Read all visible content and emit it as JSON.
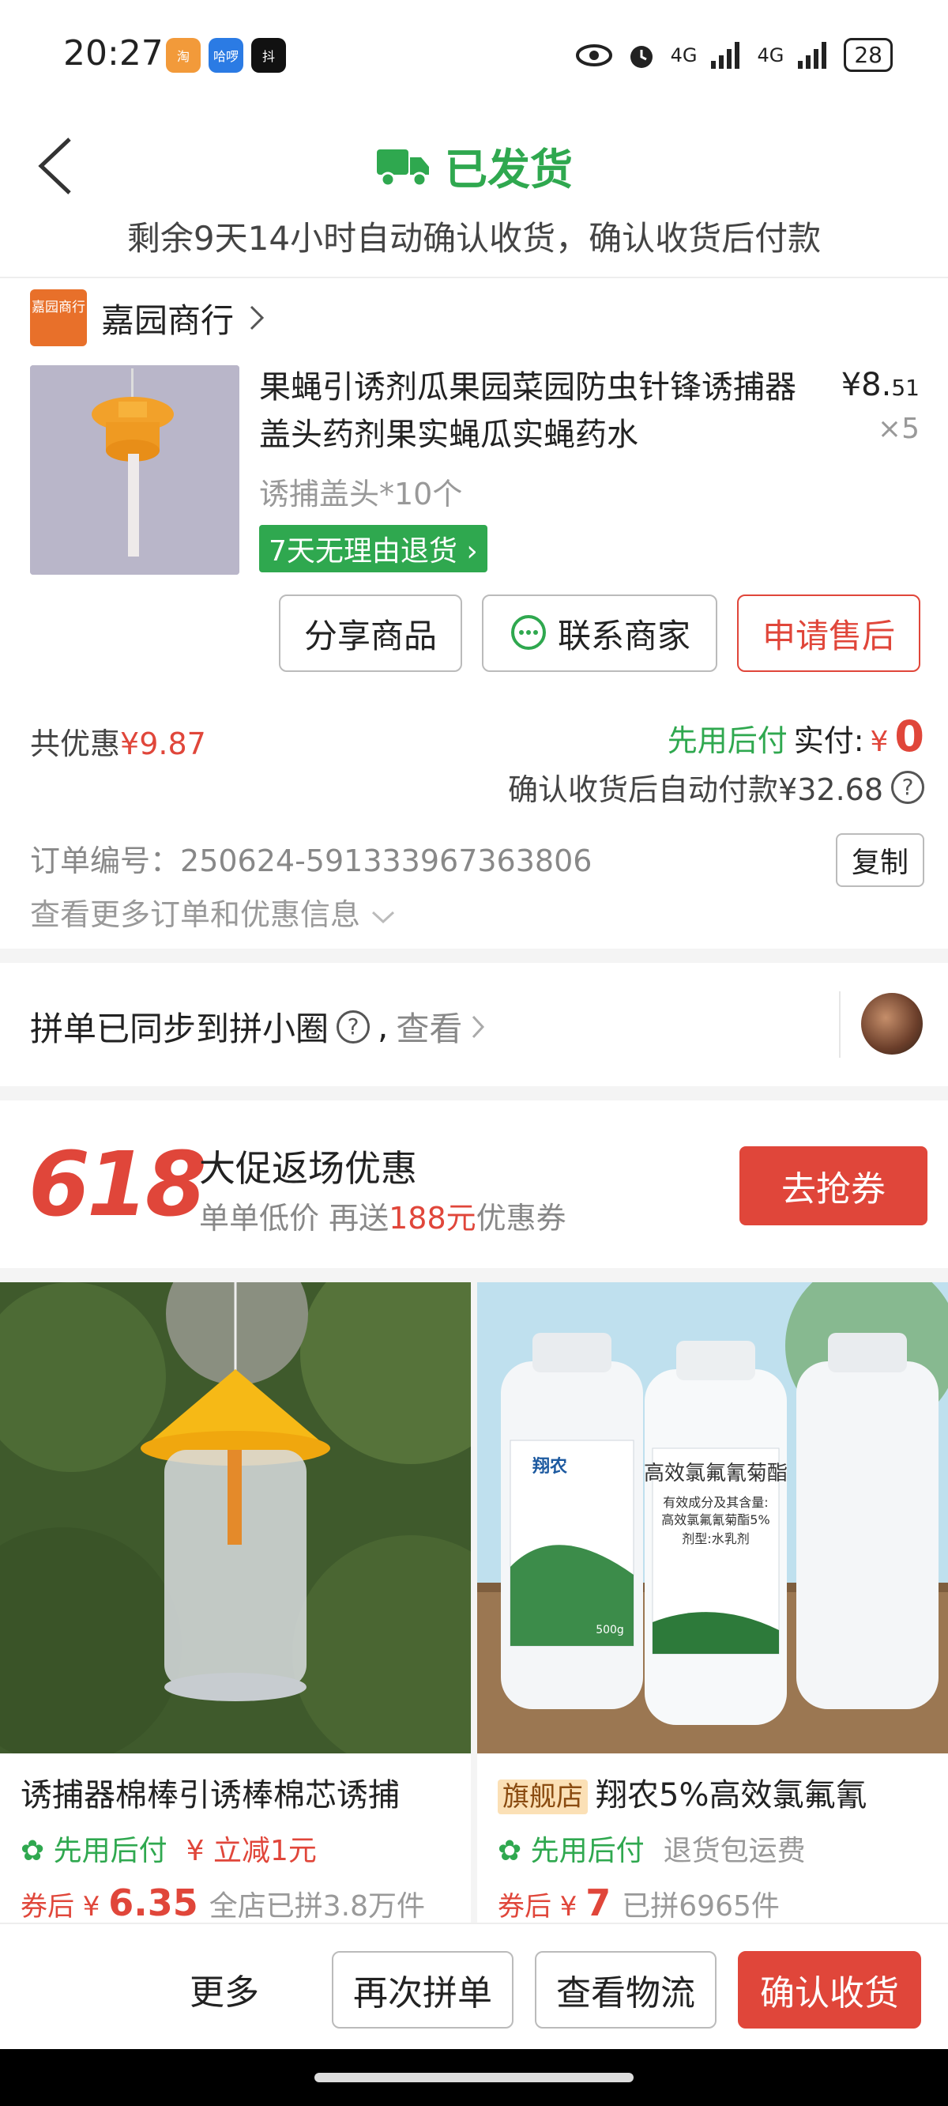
{
  "status_bar": {
    "time": "20:27",
    "apps": [
      "淘",
      "哈啰",
      "抖"
    ],
    "net1": "4G",
    "net2": "4G",
    "battery": "28"
  },
  "header": {
    "status": "已发货",
    "subtitle": "剩余9天14小时自动确认收货，确认收货后付款"
  },
  "order": {
    "shop_logo": "嘉园商行",
    "shop_name": "嘉园商行",
    "title": "果蝇引诱剂瓜果园菜园防虫针锋诱捕器盖头药剂果实蝇瓜实蝇药水",
    "price_int": "¥8.",
    "price_dec": "51",
    "qty": "×5",
    "spec": "诱捕盖头*10个",
    "badge": "7天无理由退货",
    "buttons": {
      "share": "分享商品",
      "contact": "联系商家",
      "aftersale": "申请售后"
    },
    "discount_label": "共优惠",
    "discount_value": "¥9.87",
    "pay_later": "先用后付",
    "paid_label": "实付:",
    "paid_currency": "¥",
    "paid_value": "0",
    "autopay": "确认收货后自动付款¥32.68",
    "order_no_label": "订单编号：",
    "order_no": "250624-591333967363806",
    "copy": "复制",
    "more_info": "查看更多订单和优惠信息"
  },
  "group": {
    "text": "拼单已同步到拼小圈",
    "help": "?",
    "sep": ",",
    "look": "查看"
  },
  "promo": {
    "number": "618",
    "title": "大促返场优惠",
    "sub_a": "单单低价  再送",
    "sub_red": "188元",
    "sub_b": "优惠券",
    "button": "去抢券"
  },
  "goods": [
    {
      "flag": "",
      "title": "诱捕器棉棒引诱棒棉芯诱捕",
      "tag1": "先用后付",
      "tag2": "立减1元",
      "price_prefix": "券后 ¥",
      "price": "6.35",
      "sales": "全店已拼3.8万件"
    },
    {
      "flag": "旗舰店",
      "title": "翔农5%高效氯氟氰",
      "tag1": "先用后付",
      "tag2": "退货包运费",
      "price_prefix": "券后 ¥",
      "price": "7",
      "sales": "已拼6965件",
      "bottle_brand": "翔农",
      "bottle_label": "高效氯氟氰菊酯",
      "bottle_sub1": "有效成分及其含量:",
      "bottle_sub2": "高效氯氟氰菊酯5%",
      "bottle_sub3": "剂型:水乳剂",
      "bottle_vol": "500g"
    }
  ],
  "bottom": {
    "more": "更多",
    "reorder": "再次拼单",
    "logistics": "查看物流",
    "confirm": "确认收货"
  },
  "colors": {
    "green": "#2fa84f",
    "red": "#e0463a"
  }
}
